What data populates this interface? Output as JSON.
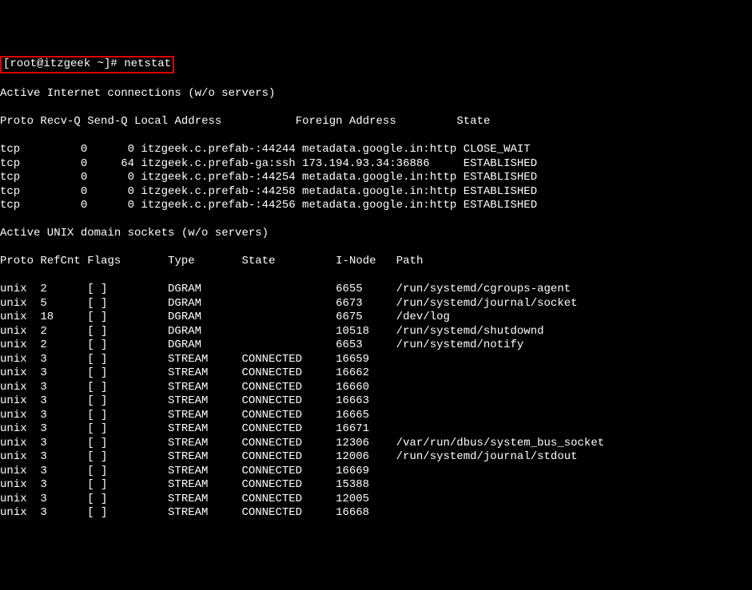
{
  "prompt_user_host": "[root@itzgeek ~]#",
  "prompt_command": "netstat",
  "section1_title": "Active Internet connections (w/o servers)",
  "net_headers": {
    "proto": "Proto",
    "recvq": "Recv-Q",
    "sendq": "Send-Q",
    "local": "Local Address",
    "foreign": "Foreign Address",
    "state": "State"
  },
  "net_rows": [
    {
      "proto": "tcp",
      "recvq": "0",
      "sendq": "0",
      "local": "itzgeek.c.prefab-:44244",
      "foreign": "metadata.google.in:http",
      "state": "CLOSE_WAIT"
    },
    {
      "proto": "tcp",
      "recvq": "0",
      "sendq": "64",
      "local": "itzgeek.c.prefab-ga:ssh",
      "foreign": "173.194.93.34:36886",
      "state": "ESTABLISHED"
    },
    {
      "proto": "tcp",
      "recvq": "0",
      "sendq": "0",
      "local": "itzgeek.c.prefab-:44254",
      "foreign": "metadata.google.in:http",
      "state": "ESTABLISHED"
    },
    {
      "proto": "tcp",
      "recvq": "0",
      "sendq": "0",
      "local": "itzgeek.c.prefab-:44258",
      "foreign": "metadata.google.in:http",
      "state": "ESTABLISHED"
    },
    {
      "proto": "tcp",
      "recvq": "0",
      "sendq": "0",
      "local": "itzgeek.c.prefab-:44256",
      "foreign": "metadata.google.in:http",
      "state": "ESTABLISHED"
    }
  ],
  "section2_title": "Active UNIX domain sockets (w/o servers)",
  "unix_headers": {
    "proto": "Proto",
    "refcnt": "RefCnt",
    "flags": "Flags",
    "type": "Type",
    "state": "State",
    "inode": "I-Node",
    "path": "Path"
  },
  "unix_rows": [
    {
      "proto": "unix",
      "refcnt": "2",
      "flags": "[ ]",
      "type": "DGRAM",
      "state": "",
      "inode": "6655",
      "path": "/run/systemd/cgroups-agent"
    },
    {
      "proto": "unix",
      "refcnt": "5",
      "flags": "[ ]",
      "type": "DGRAM",
      "state": "",
      "inode": "6673",
      "path": "/run/systemd/journal/socket"
    },
    {
      "proto": "unix",
      "refcnt": "18",
      "flags": "[ ]",
      "type": "DGRAM",
      "state": "",
      "inode": "6675",
      "path": "/dev/log"
    },
    {
      "proto": "unix",
      "refcnt": "2",
      "flags": "[ ]",
      "type": "DGRAM",
      "state": "",
      "inode": "10518",
      "path": "/run/systemd/shutdownd"
    },
    {
      "proto": "unix",
      "refcnt": "2",
      "flags": "[ ]",
      "type": "DGRAM",
      "state": "",
      "inode": "6653",
      "path": "/run/systemd/notify"
    },
    {
      "proto": "unix",
      "refcnt": "3",
      "flags": "[ ]",
      "type": "STREAM",
      "state": "CONNECTED",
      "inode": "16659",
      "path": ""
    },
    {
      "proto": "unix",
      "refcnt": "3",
      "flags": "[ ]",
      "type": "STREAM",
      "state": "CONNECTED",
      "inode": "16662",
      "path": ""
    },
    {
      "proto": "unix",
      "refcnt": "3",
      "flags": "[ ]",
      "type": "STREAM",
      "state": "CONNECTED",
      "inode": "16660",
      "path": ""
    },
    {
      "proto": "unix",
      "refcnt": "3",
      "flags": "[ ]",
      "type": "STREAM",
      "state": "CONNECTED",
      "inode": "16663",
      "path": ""
    },
    {
      "proto": "unix",
      "refcnt": "3",
      "flags": "[ ]",
      "type": "STREAM",
      "state": "CONNECTED",
      "inode": "16665",
      "path": ""
    },
    {
      "proto": "unix",
      "refcnt": "3",
      "flags": "[ ]",
      "type": "STREAM",
      "state": "CONNECTED",
      "inode": "16671",
      "path": ""
    },
    {
      "proto": "unix",
      "refcnt": "3",
      "flags": "[ ]",
      "type": "STREAM",
      "state": "CONNECTED",
      "inode": "12306",
      "path": "/var/run/dbus/system_bus_socket"
    },
    {
      "proto": "unix",
      "refcnt": "3",
      "flags": "[ ]",
      "type": "STREAM",
      "state": "CONNECTED",
      "inode": "12006",
      "path": "/run/systemd/journal/stdout"
    },
    {
      "proto": "unix",
      "refcnt": "3",
      "flags": "[ ]",
      "type": "STREAM",
      "state": "CONNECTED",
      "inode": "16669",
      "path": ""
    },
    {
      "proto": "unix",
      "refcnt": "3",
      "flags": "[ ]",
      "type": "STREAM",
      "state": "CONNECTED",
      "inode": "15388",
      "path": ""
    },
    {
      "proto": "unix",
      "refcnt": "3",
      "flags": "[ ]",
      "type": "STREAM",
      "state": "CONNECTED",
      "inode": "12005",
      "path": ""
    },
    {
      "proto": "unix",
      "refcnt": "3",
      "flags": "[ ]",
      "type": "STREAM",
      "state": "CONNECTED",
      "inode": "16668",
      "path": ""
    }
  ]
}
